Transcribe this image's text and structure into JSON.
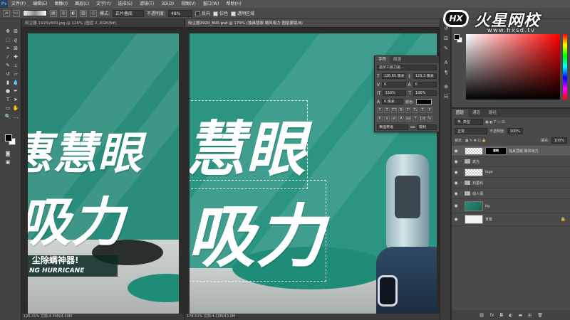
{
  "menu": {
    "app_logo": "Ps",
    "items": [
      "文件(F)",
      "编辑(E)",
      "图像(I)",
      "图层(L)",
      "文字(Y)",
      "选择(S)",
      "滤镜(T)",
      "3D(D)",
      "视图(V)",
      "窗口(W)",
      "帮助(H)"
    ]
  },
  "options_bar": {
    "mode_label": "模式:",
    "mode_value": "正片叠底",
    "opacity_label": "不透明度:",
    "opacity_value": "48%",
    "reverse_label": "反向",
    "dither_label": "仿色",
    "transparency_label": "透明区域"
  },
  "documents": [
    {
      "tab_title": "吸尘器-1920x800.jpg @ 126% (图层 2, RGB/8#)",
      "status": "126.41%     文档:4.39M/4.39M",
      "headline_1": "惠慧眼",
      "headline_2": "吸力",
      "subtitle_cn": "尘除螨神器!",
      "subtitle_en": "NG HURRICANE"
    },
    {
      "tab_title": "吸尘器1920_800.psd @ 179% (独具慧眼  飓风吸力  图层蒙版/8)",
      "status": "178.51%     文档:4.39M/43.0M",
      "headline_1": "慧眼",
      "headline_2": "吸力"
    }
  ],
  "character_panel": {
    "tabs": [
      "字符",
      "段落"
    ],
    "font_family": "造字工房力黑...",
    "font_size": "126.65 像素",
    "leading": "129.3 像素",
    "kerning": "0",
    "tracking": "0",
    "vertical_scale": "100%",
    "horizontal_scale": "100%",
    "baseline_shift": "0 像素",
    "color_label": "颜色:",
    "language": "美国英语",
    "antialias": "锐利"
  },
  "colors": {
    "canvas_teal": "#2a8c7b",
    "fg_color": "#000000",
    "bg_color": "#ffffff"
  },
  "watermark": {
    "badge": "HX",
    "title": "火星网校",
    "url": "www.hxsd.tv"
  },
  "layers_panel": {
    "tabs": [
      "图层",
      "通道",
      "路径"
    ],
    "filter_label": "类型",
    "blend_mode": "正常",
    "opacity_label": "不透明度:",
    "opacity_value": "100%",
    "lock_label": "锁定:",
    "fill_label": "填充:",
    "fill_value": "100%",
    "layers": [
      {
        "name": "独具慧眼  飓风吸力",
        "type": "masked",
        "selected": true
      },
      {
        "name": "高光",
        "type": "folder"
      },
      {
        "name": "logo",
        "type": "layer"
      },
      {
        "name": "石墨科",
        "type": "folder"
      },
      {
        "name": "动人语",
        "type": "folder"
      },
      {
        "name": "bg",
        "type": "layer"
      },
      {
        "name": "背景",
        "type": "background"
      }
    ]
  }
}
